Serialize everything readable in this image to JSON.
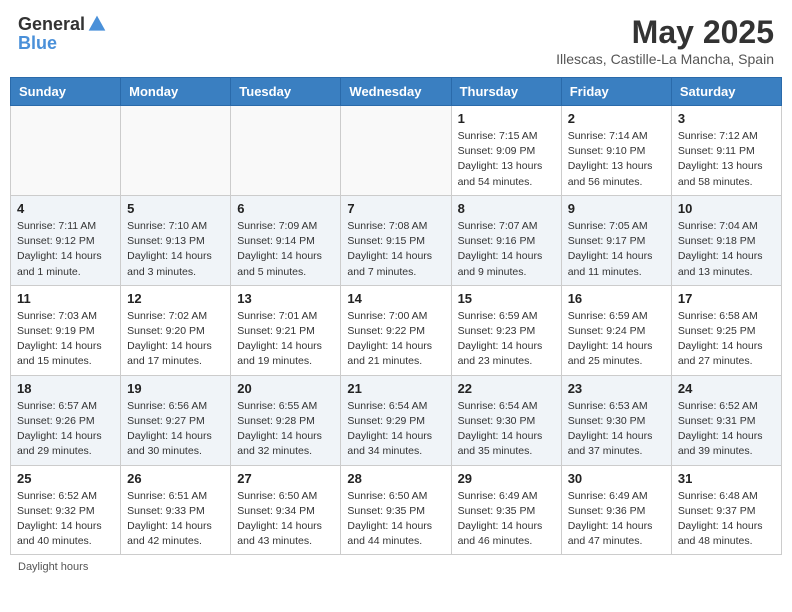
{
  "header": {
    "logo_general": "General",
    "logo_blue": "Blue",
    "month_year": "May 2025",
    "subtitle": "Illescas, Castille-La Mancha, Spain"
  },
  "days_of_week": [
    "Sunday",
    "Monday",
    "Tuesday",
    "Wednesday",
    "Thursday",
    "Friday",
    "Saturday"
  ],
  "legend": "Daylight hours",
  "weeks": [
    [
      {
        "day": "",
        "info": ""
      },
      {
        "day": "",
        "info": ""
      },
      {
        "day": "",
        "info": ""
      },
      {
        "day": "",
        "info": ""
      },
      {
        "day": "1",
        "info": "Sunrise: 7:15 AM\nSunset: 9:09 PM\nDaylight: 13 hours\nand 54 minutes."
      },
      {
        "day": "2",
        "info": "Sunrise: 7:14 AM\nSunset: 9:10 PM\nDaylight: 13 hours\nand 56 minutes."
      },
      {
        "day": "3",
        "info": "Sunrise: 7:12 AM\nSunset: 9:11 PM\nDaylight: 13 hours\nand 58 minutes."
      }
    ],
    [
      {
        "day": "4",
        "info": "Sunrise: 7:11 AM\nSunset: 9:12 PM\nDaylight: 14 hours\nand 1 minute."
      },
      {
        "day": "5",
        "info": "Sunrise: 7:10 AM\nSunset: 9:13 PM\nDaylight: 14 hours\nand 3 minutes."
      },
      {
        "day": "6",
        "info": "Sunrise: 7:09 AM\nSunset: 9:14 PM\nDaylight: 14 hours\nand 5 minutes."
      },
      {
        "day": "7",
        "info": "Sunrise: 7:08 AM\nSunset: 9:15 PM\nDaylight: 14 hours\nand 7 minutes."
      },
      {
        "day": "8",
        "info": "Sunrise: 7:07 AM\nSunset: 9:16 PM\nDaylight: 14 hours\nand 9 minutes."
      },
      {
        "day": "9",
        "info": "Sunrise: 7:05 AM\nSunset: 9:17 PM\nDaylight: 14 hours\nand 11 minutes."
      },
      {
        "day": "10",
        "info": "Sunrise: 7:04 AM\nSunset: 9:18 PM\nDaylight: 14 hours\nand 13 minutes."
      }
    ],
    [
      {
        "day": "11",
        "info": "Sunrise: 7:03 AM\nSunset: 9:19 PM\nDaylight: 14 hours\nand 15 minutes."
      },
      {
        "day": "12",
        "info": "Sunrise: 7:02 AM\nSunset: 9:20 PM\nDaylight: 14 hours\nand 17 minutes."
      },
      {
        "day": "13",
        "info": "Sunrise: 7:01 AM\nSunset: 9:21 PM\nDaylight: 14 hours\nand 19 minutes."
      },
      {
        "day": "14",
        "info": "Sunrise: 7:00 AM\nSunset: 9:22 PM\nDaylight: 14 hours\nand 21 minutes."
      },
      {
        "day": "15",
        "info": "Sunrise: 6:59 AM\nSunset: 9:23 PM\nDaylight: 14 hours\nand 23 minutes."
      },
      {
        "day": "16",
        "info": "Sunrise: 6:59 AM\nSunset: 9:24 PM\nDaylight: 14 hours\nand 25 minutes."
      },
      {
        "day": "17",
        "info": "Sunrise: 6:58 AM\nSunset: 9:25 PM\nDaylight: 14 hours\nand 27 minutes."
      }
    ],
    [
      {
        "day": "18",
        "info": "Sunrise: 6:57 AM\nSunset: 9:26 PM\nDaylight: 14 hours\nand 29 minutes."
      },
      {
        "day": "19",
        "info": "Sunrise: 6:56 AM\nSunset: 9:27 PM\nDaylight: 14 hours\nand 30 minutes."
      },
      {
        "day": "20",
        "info": "Sunrise: 6:55 AM\nSunset: 9:28 PM\nDaylight: 14 hours\nand 32 minutes."
      },
      {
        "day": "21",
        "info": "Sunrise: 6:54 AM\nSunset: 9:29 PM\nDaylight: 14 hours\nand 34 minutes."
      },
      {
        "day": "22",
        "info": "Sunrise: 6:54 AM\nSunset: 9:30 PM\nDaylight: 14 hours\nand 35 minutes."
      },
      {
        "day": "23",
        "info": "Sunrise: 6:53 AM\nSunset: 9:30 PM\nDaylight: 14 hours\nand 37 minutes."
      },
      {
        "day": "24",
        "info": "Sunrise: 6:52 AM\nSunset: 9:31 PM\nDaylight: 14 hours\nand 39 minutes."
      }
    ],
    [
      {
        "day": "25",
        "info": "Sunrise: 6:52 AM\nSunset: 9:32 PM\nDaylight: 14 hours\nand 40 minutes."
      },
      {
        "day": "26",
        "info": "Sunrise: 6:51 AM\nSunset: 9:33 PM\nDaylight: 14 hours\nand 42 minutes."
      },
      {
        "day": "27",
        "info": "Sunrise: 6:50 AM\nSunset: 9:34 PM\nDaylight: 14 hours\nand 43 minutes."
      },
      {
        "day": "28",
        "info": "Sunrise: 6:50 AM\nSunset: 9:35 PM\nDaylight: 14 hours\nand 44 minutes."
      },
      {
        "day": "29",
        "info": "Sunrise: 6:49 AM\nSunset: 9:35 PM\nDaylight: 14 hours\nand 46 minutes."
      },
      {
        "day": "30",
        "info": "Sunrise: 6:49 AM\nSunset: 9:36 PM\nDaylight: 14 hours\nand 47 minutes."
      },
      {
        "day": "31",
        "info": "Sunrise: 6:48 AM\nSunset: 9:37 PM\nDaylight: 14 hours\nand 48 minutes."
      }
    ]
  ]
}
